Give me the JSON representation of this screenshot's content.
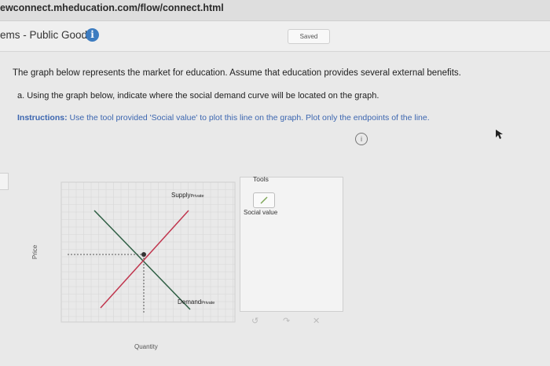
{
  "browser": {
    "url": "ewconnect.mheducation.com/flow/connect.html"
  },
  "header": {
    "title": "ems - Public Goods",
    "info_icon": "info-icon",
    "saved_label": "Saved"
  },
  "question": {
    "intro": "The graph below represents the market for education. Assume that education provides several external benefits.",
    "part_a": "a. Using the graph below, indicate where the social demand curve will be located on the graph.",
    "instructions_label": "Instructions:",
    "instructions_text": "Use the tool provided 'Social value' to plot this line on the graph. Plot only the endpoints of the line."
  },
  "graph": {
    "y_axis_label": "Price",
    "x_axis_label": "Quantity",
    "supply_label": "Supply",
    "supply_sub": "Private",
    "demand_label": "Demand",
    "demand_sub": "Private",
    "colors": {
      "supply": "#c0354d",
      "demand": "#2f5f44",
      "grid": "#d7d7d7",
      "dotted": "#555555"
    }
  },
  "tools": {
    "title": "Tools",
    "social_value_label": "Social value",
    "icons": [
      "undo-icon",
      "redo-icon",
      "reset-icon"
    ]
  }
}
